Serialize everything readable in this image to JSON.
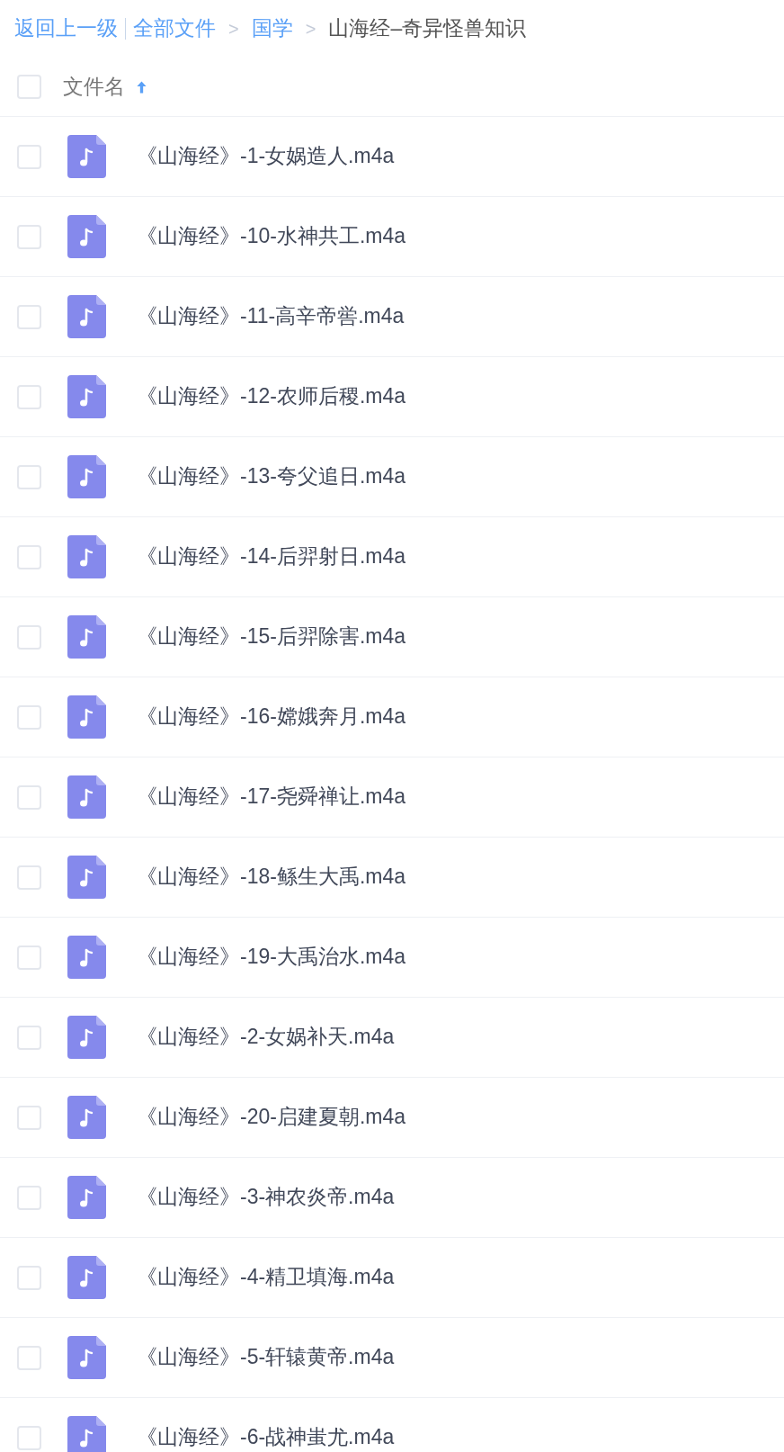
{
  "breadcrumb": {
    "back": "返回上一级",
    "items": [
      {
        "label": "全部文件",
        "current": false
      },
      {
        "separator": ">",
        "label": "国学",
        "current": false
      },
      {
        "separator": ">",
        "label": "山海经–奇异怪兽知识",
        "current": true
      }
    ]
  },
  "header": {
    "select_all": {
      "checked": false
    },
    "column": "文件名",
    "sort_ascending": true
  },
  "files": [
    {
      "name": "《山海经》-1-女娲造人.m4a",
      "checked": false
    },
    {
      "name": "《山海经》-10-水神共工.m4a",
      "checked": false
    },
    {
      "name": "《山海经》-11-高辛帝喾.m4a",
      "checked": false
    },
    {
      "name": "《山海经》-12-农师后稷.m4a",
      "checked": false
    },
    {
      "name": "《山海经》-13-夸父追日.m4a",
      "checked": false
    },
    {
      "name": "《山海经》-14-后羿射日.m4a",
      "checked": false
    },
    {
      "name": "《山海经》-15-后羿除害.m4a",
      "checked": false
    },
    {
      "name": "《山海经》-16-嫦娥奔月.m4a",
      "checked": false
    },
    {
      "name": "《山海经》-17-尧舜禅让.m4a",
      "checked": false
    },
    {
      "name": "《山海经》-18-鲧生大禹.m4a",
      "checked": false
    },
    {
      "name": "《山海经》-19-大禹治水.m4a",
      "checked": false
    },
    {
      "name": "《山海经》-2-女娲补天.m4a",
      "checked": false
    },
    {
      "name": "《山海经》-20-启建夏朝.m4a",
      "checked": false
    },
    {
      "name": "《山海经》-3-神农炎帝.m4a",
      "checked": false
    },
    {
      "name": "《山海经》-4-精卫填海.m4a",
      "checked": false
    },
    {
      "name": "《山海经》-5-轩辕黄帝.m4a",
      "checked": false
    },
    {
      "name": "《山海经》-6-战神蚩尤.m4a",
      "checked": false
    }
  ]
}
